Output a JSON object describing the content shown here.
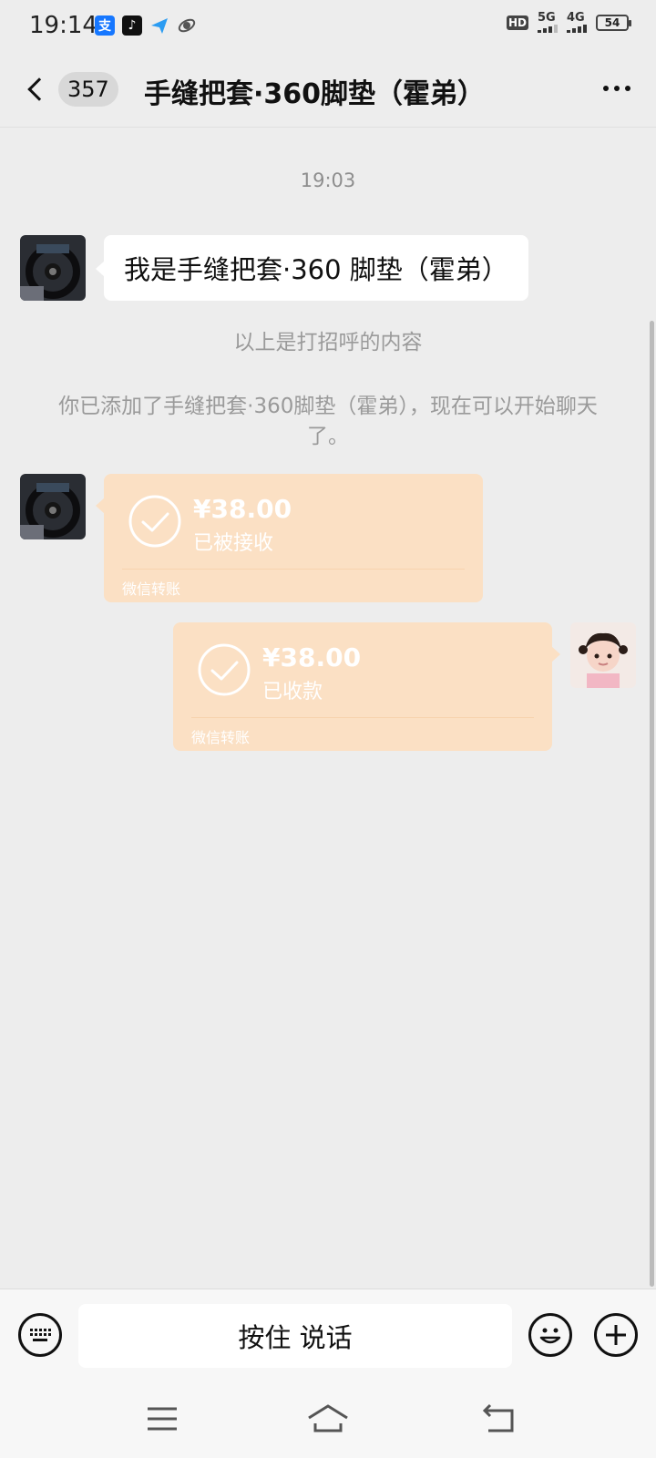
{
  "status_bar": {
    "time": "19:14",
    "hd": "HD",
    "hd_sub": "1\n2",
    "net_5g": "5G",
    "net_4g": "4G",
    "battery": "54"
  },
  "header": {
    "unread_count": "357",
    "title": "手缝把套·360脚垫（霍弟）"
  },
  "chat": {
    "timestamp": "19:03",
    "greeting_message": "我是手缝把套·360 脚垫（霍弟）",
    "note_greeting": "以上是打招呼的内容",
    "note_added": "你已添加了手缝把套·360脚垫（霍弟），现在可以开始聊天了。",
    "transfer_received": {
      "amount": "¥38.00",
      "status": "已被接收",
      "label": "微信转账"
    },
    "transfer_collected": {
      "amount": "¥38.00",
      "status": "已收款",
      "label": "微信转账"
    }
  },
  "input_bar": {
    "voice_label": "按住 说话"
  },
  "colors": {
    "background": "#ededed",
    "transfer_bubble": "#fbe0c4",
    "bubble_white": "#ffffff"
  },
  "icons": [
    "keyboard-icon",
    "emoji-icon",
    "plus-icon",
    "menu-icon",
    "home-icon",
    "back-nav-icon",
    "more-icon"
  ]
}
